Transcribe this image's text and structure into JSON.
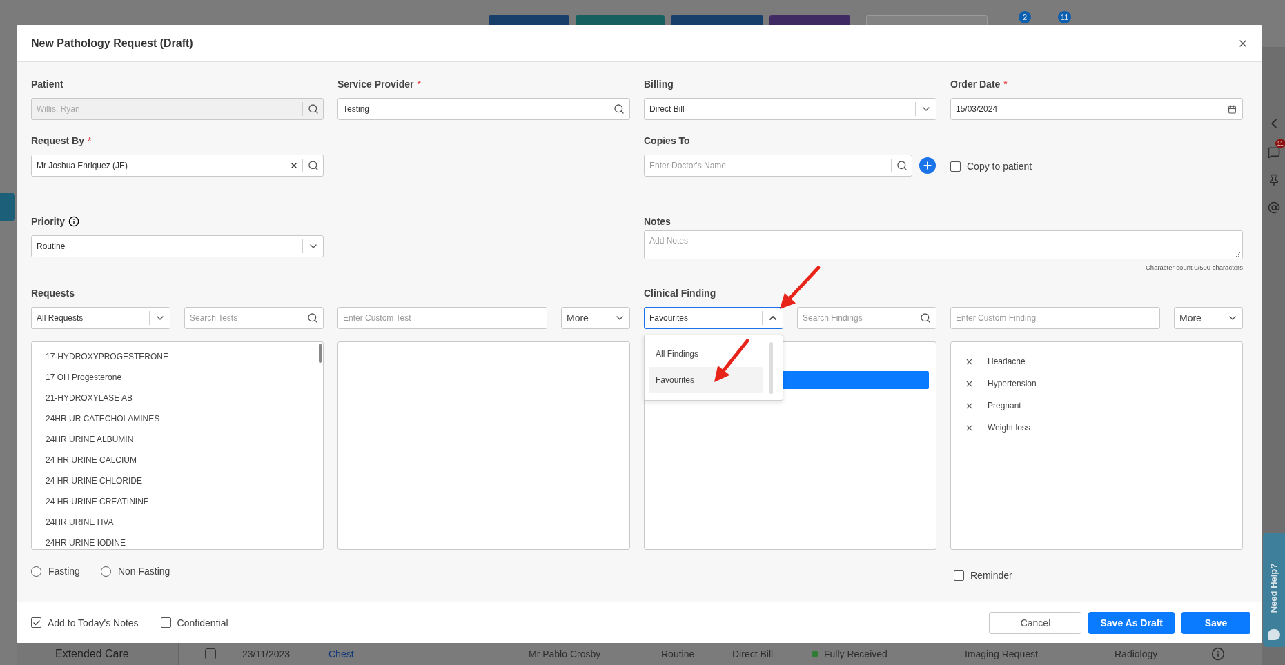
{
  "backdrop": {
    "top_badges": [
      "2",
      "11"
    ],
    "sidebar_badge": "11",
    "help_tab": "Need Help?",
    "table_row": {
      "section": "Extended Care",
      "checked": false,
      "date": "23/11/2023",
      "type": "Chest",
      "doctor": "Mr Pablo Crosby",
      "priority": "Routine",
      "billing": "Direct Bill",
      "status": {
        "label": "Fully Received",
        "color": "#2e7d32"
      },
      "category": "Imaging Request",
      "department": "Radiology"
    }
  },
  "dialog": {
    "title": "New Pathology Request (Draft)",
    "patient": {
      "label": "Patient",
      "value": "Willis, Ryan",
      "disabled": true
    },
    "service_provider": {
      "label": "Service Provider",
      "required_mark": "*",
      "value": "Testing"
    },
    "billing": {
      "label": "Billing",
      "value": "Direct Bill"
    },
    "order_date": {
      "label": "Order Date",
      "required_mark": "*",
      "value": "15/03/2024"
    },
    "request_by": {
      "label": "Request By",
      "required_mark": "*",
      "value": "Mr Joshua Enriquez (JE)"
    },
    "copies_to": {
      "label": "Copies To",
      "placeholder": "Enter Doctor's Name"
    },
    "copy_to_patient": {
      "label": "Copy to patient",
      "checked": false
    },
    "priority": {
      "label": "Priority",
      "value": "Routine"
    },
    "notes": {
      "label": "Notes",
      "placeholder": "Add Notes",
      "counter": "Character count 0/500 characters"
    },
    "requests": {
      "label": "Requests",
      "filter": "All Requests",
      "search_placeholder": "Search Tests",
      "custom_placeholder": "Enter Custom Test",
      "more": "More",
      "tests": [
        "17-HYDROXYPROGESTERONE",
        "17 OH Progesterone",
        "21-HYDROXYLASE AB",
        "24HR UR CATECHOLAMINES",
        "24HR URINE ALBUMIN",
        "24 HR URINE CALCIUM",
        "24 HR URINE CHLORIDE",
        "24 HR URINE CREATININE",
        "24HR URINE HVA",
        "24HR URINE IODINE"
      ]
    },
    "fasting": [
      {
        "label": "Fasting",
        "selected": false
      },
      {
        "label": "Non Fasting",
        "selected": false
      }
    ],
    "clinical_finding": {
      "label": "Clinical Finding",
      "filter": "Favourites",
      "open": true,
      "options": [
        {
          "label": "All Findings",
          "selected": false
        },
        {
          "label": "Favourites",
          "selected": true
        }
      ],
      "search_placeholder": "Search Findings",
      "custom_placeholder": "Enter Custom Finding",
      "more": "More",
      "selected_findings": [
        "Headache",
        "Hypertension",
        "Pregnant",
        "Weight loss"
      ]
    },
    "reminder": {
      "label": "Reminder",
      "checked": false
    },
    "add_to_notes": {
      "label": "Add to Today's Notes",
      "checked": true
    },
    "confidential": {
      "label": "Confidential",
      "checked": false
    },
    "buttons": [
      {
        "label": "Cancel",
        "kind": "secondary"
      },
      {
        "label": "Save As Draft",
        "kind": "primary"
      },
      {
        "label": "Save",
        "kind": "primary"
      }
    ]
  },
  "annotations": [
    {
      "kind": "arrow"
    },
    {
      "kind": "arrow"
    }
  ]
}
